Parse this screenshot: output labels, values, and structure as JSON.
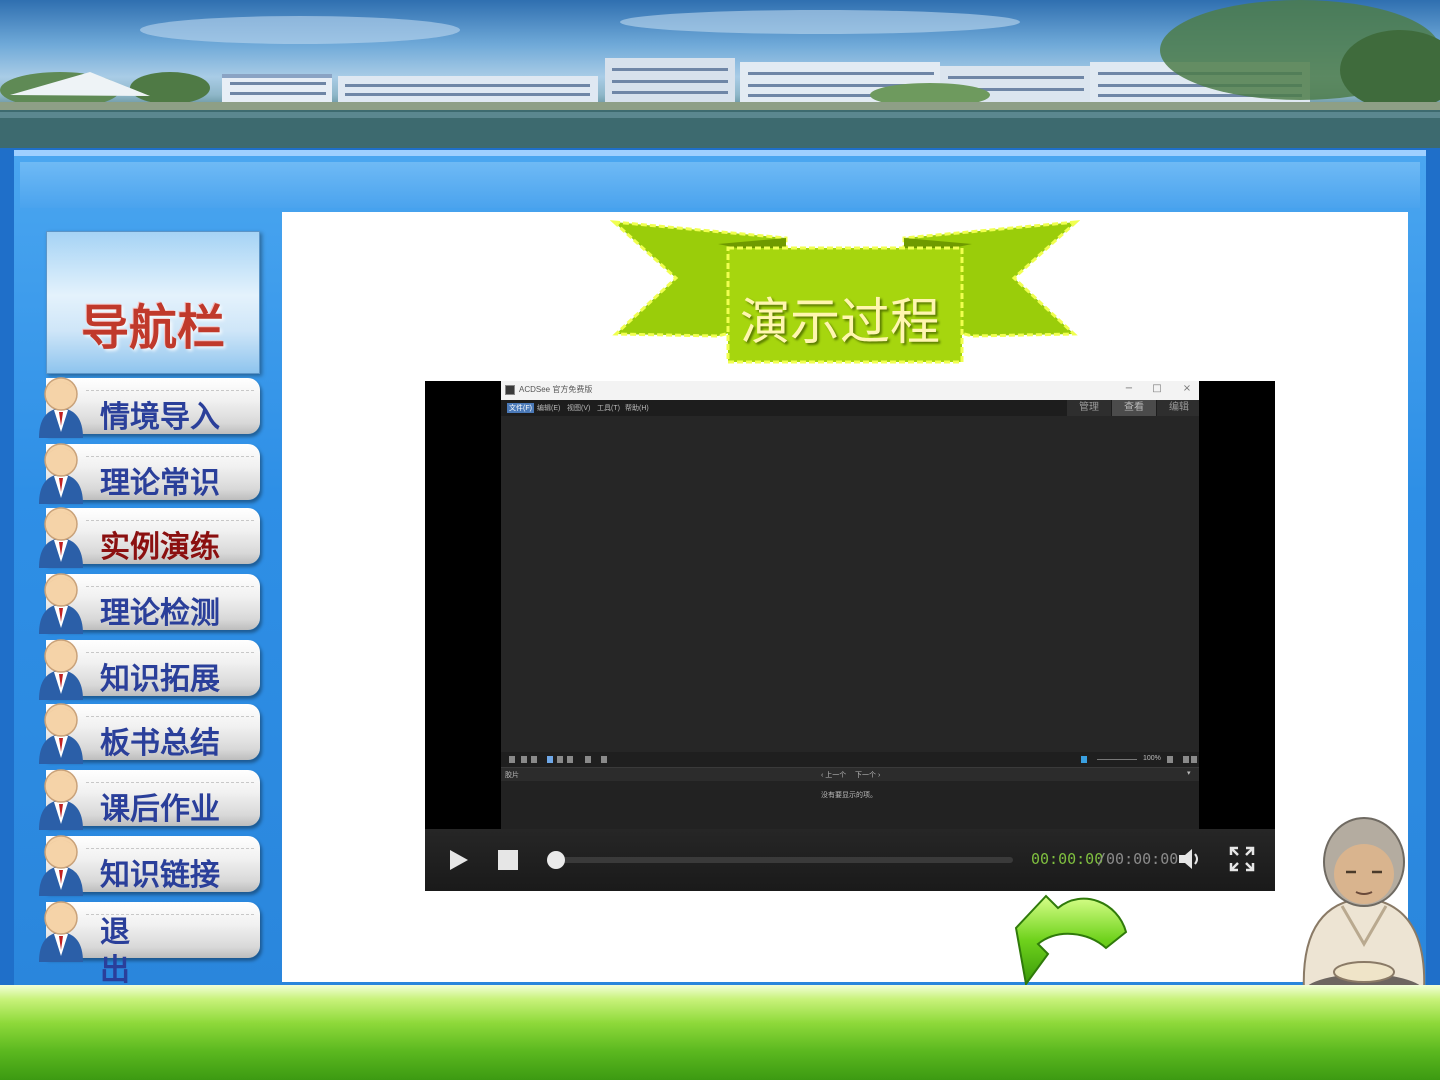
{
  "nav": {
    "title": "导航栏",
    "items": [
      {
        "label": "情境导入",
        "active": false
      },
      {
        "label": "理论常识",
        "active": false
      },
      {
        "label": "实例演练",
        "active": true
      },
      {
        "label": "理论检测",
        "active": false
      },
      {
        "label": "知识拓展",
        "active": false
      },
      {
        "label": "板书总结",
        "active": false
      },
      {
        "label": "课后作业",
        "active": false
      },
      {
        "label": "知识链接",
        "active": false
      },
      {
        "label": "退出",
        "active": false
      }
    ]
  },
  "ribbon": {
    "title": "演示过程"
  },
  "video": {
    "app": {
      "window_title": "ACDSee 官方免费版",
      "window_controls": [
        "−",
        "□",
        "×"
      ],
      "menu": [
        "文件(F)",
        "编辑(E)",
        "视图(V)",
        "工具(T)",
        "帮助(H)"
      ],
      "modes": [
        "管理",
        "查看",
        "编辑"
      ],
      "selected_mode": "查看",
      "zoom": "100%",
      "panel_label": "胶片",
      "prev": "‹ 上一个",
      "next": "下一个 ›",
      "empty_message": "没有要显示的项。"
    },
    "current_time": "00:00:00",
    "total_time": "/00:00:00",
    "progress": 0
  },
  "colors": {
    "nav_text": "#2a3f9a",
    "nav_active_text": "#8b1010",
    "nav_title": "#c0392b",
    "ribbon_fill": "#9acd0a",
    "frame_blue": "#2e8fe6",
    "time_current": "#7fbf3f"
  },
  "icons": {
    "play": "play-icon",
    "stop": "stop-icon",
    "volume": "volume-icon",
    "fullscreen": "fullscreen-icon",
    "back": "back-arrow-icon"
  }
}
